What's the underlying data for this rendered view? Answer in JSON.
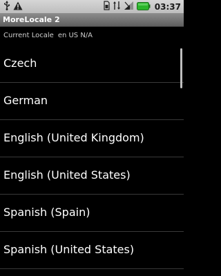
{
  "status_bar": {
    "time": "03:37",
    "icons": [
      "usb-icon",
      "warning-icon",
      "sim-icon",
      "network-icon",
      "signal-icon",
      "battery-icon"
    ]
  },
  "app": {
    "title": "MoreLocale 2"
  },
  "current_locale": {
    "label": "Current Locale",
    "value": "en US N/A"
  },
  "locales": [
    {
      "label": "Czech"
    },
    {
      "label": "German"
    },
    {
      "label": "English (United Kingdom)"
    },
    {
      "label": "English (United States)"
    },
    {
      "label": "Spanish (Spain)"
    },
    {
      "label": "Spanish (United States)"
    }
  ],
  "colors": {
    "background": "#000000",
    "status_bar": "#cccccc",
    "title_bar": "#777777",
    "text": "#ffffff",
    "battery": "#2bb52b"
  }
}
